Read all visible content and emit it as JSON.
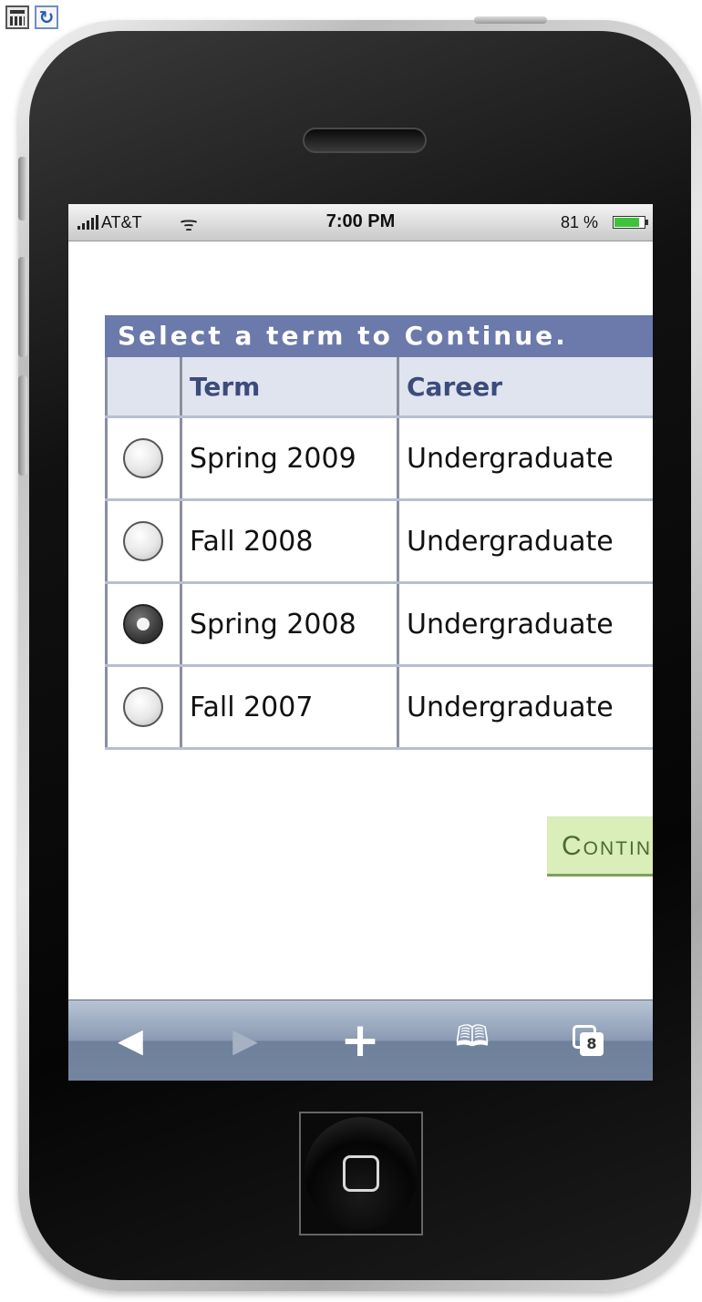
{
  "toolbar_icons": {
    "calculator": "calculator-icon",
    "refresh": "refresh-icon"
  },
  "status_bar": {
    "carrier": "AT&T",
    "time": "7:00 PM",
    "battery": "81 %"
  },
  "term_grid": {
    "title": "Select a term to Continue.",
    "headers": [
      "",
      "Term",
      "Career"
    ],
    "rows": [
      {
        "term": "Spring 2009",
        "career": "Undergraduate",
        "selected": false
      },
      {
        "term": "Fall 2008",
        "career": "Undergraduate",
        "selected": false
      },
      {
        "term": "Spring 2008",
        "career": "Undergraduate",
        "selected": true
      },
      {
        "term": "Fall 2007",
        "career": "Undergraduate",
        "selected": false
      }
    ]
  },
  "continue_button": {
    "label": "Continue"
  },
  "safari_toolbar": {
    "pages_count": "8"
  },
  "colors": {
    "grid_title_bg": "#6b7aab",
    "grid_header_text": "#3c4b7c",
    "continue_bg": "#d9eeb8",
    "toolbar_bg": "#8a9ab2"
  }
}
